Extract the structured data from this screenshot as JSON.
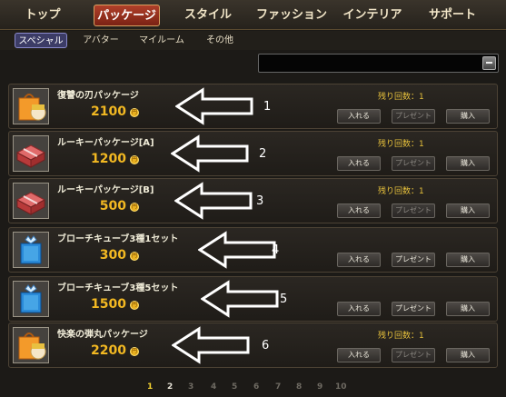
{
  "top_tabs": [
    "トップ",
    "パッケージ",
    "スタイル",
    "ファッション",
    "インテリア",
    "サポート"
  ],
  "active_top_tab": "パッケージ",
  "sub_tabs": [
    "スペシャル",
    "アバター",
    "マイルーム",
    "その他"
  ],
  "active_sub_tab": "スペシャル",
  "search": {
    "value": "",
    "placeholder": ""
  },
  "items": [
    {
      "name": "復讐の刃パッケージ",
      "price": "2100",
      "remaining": "残り回数：1",
      "icon": "orange-bag-character-icon",
      "gift_enabled": false,
      "annotation": "1"
    },
    {
      "name": "ルーキーパッケージ[A]",
      "price": "1200",
      "remaining": "残り回数：1",
      "icon": "red-box-icon",
      "gift_enabled": false,
      "annotation": "2"
    },
    {
      "name": "ルーキーパッケージ[B]",
      "price": "500",
      "remaining": "残り回数：1",
      "icon": "red-box-icon",
      "gift_enabled": false,
      "annotation": "3"
    },
    {
      "name": "ブローチキューブ3種1セット",
      "price": "300",
      "remaining": "",
      "icon": "blue-cube-icon",
      "gift_enabled": true,
      "annotation": "4"
    },
    {
      "name": "ブローチキューブ3種5セット",
      "price": "1500",
      "remaining": "",
      "icon": "blue-cube-icon",
      "gift_enabled": true,
      "annotation": "5"
    },
    {
      "name": "快楽の弾丸パッケージ",
      "price": "2200",
      "remaining": "残り回数：1",
      "icon": "orange-bag-character-icon",
      "gift_enabled": false,
      "annotation": "6"
    }
  ],
  "buttons": {
    "put_in": "入れる",
    "gift": "プレゼント",
    "buy": "購入"
  },
  "coin_symbol": "円",
  "pagination": [
    "1",
    "2",
    "3",
    "4",
    "5",
    "6",
    "7",
    "8",
    "9",
    "10"
  ],
  "current_page": "1",
  "colors": {
    "accent_price": "#f2b822",
    "remaining_text": "#e8c23c",
    "active_tab": "#b0402a"
  }
}
